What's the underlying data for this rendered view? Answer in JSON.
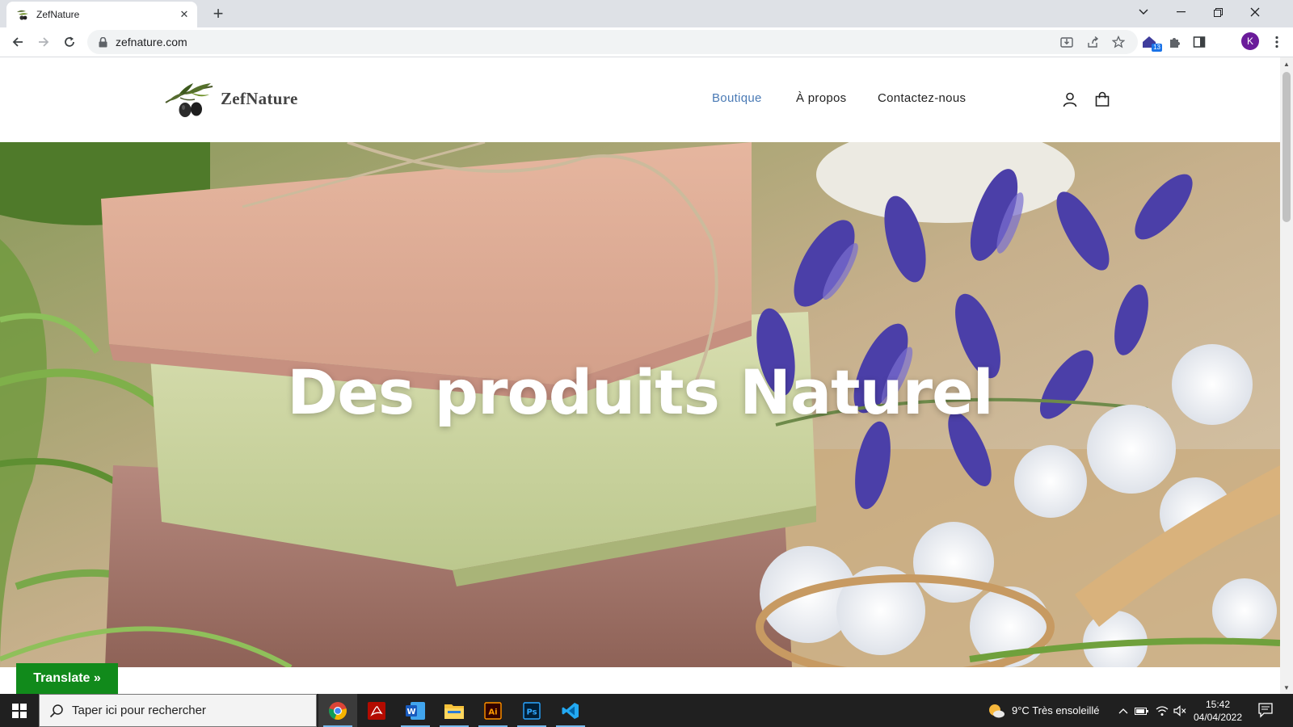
{
  "browser": {
    "tab_title": "ZefNature",
    "url": "zefnature.com",
    "profile_initial": "K",
    "extension_badge": "13"
  },
  "site": {
    "logo_text": "ZefNature",
    "nav": [
      {
        "label": "Boutique",
        "active": true
      },
      {
        "label": "À propos",
        "active": false
      },
      {
        "label": "Contactez-nous",
        "active": false
      }
    ],
    "hero_title": "Des produits Naturel",
    "translate_label": "Translate »",
    "colors": {
      "nav_active": "#4a7ab5",
      "translate_bg": "#118a1b"
    }
  },
  "taskbar": {
    "search_placeholder": "Taper ici pour rechercher",
    "weather": "9°C  Très ensoleillé",
    "time": "15:42",
    "date": "04/04/2022",
    "apps": [
      "chrome-icon",
      "acrobat-icon",
      "word-icon",
      "file-explorer-icon",
      "illustrator-icon",
      "photoshop-icon",
      "vscode-icon"
    ]
  }
}
